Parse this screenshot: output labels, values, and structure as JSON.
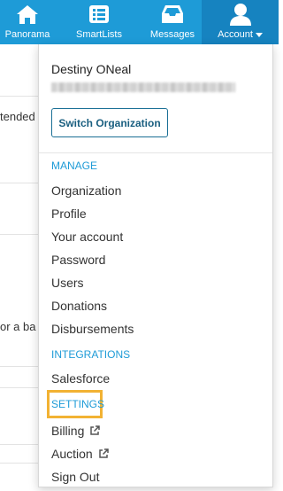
{
  "topbar": {
    "nav": [
      {
        "label": "Panorama",
        "icon": "home-icon"
      },
      {
        "label": "SmartLists",
        "icon": "list-icon"
      },
      {
        "label": "Messages",
        "icon": "inbox-icon"
      },
      {
        "label": "Account",
        "icon": "user-icon"
      }
    ]
  },
  "background": {
    "fragment1": "tended",
    "fragment2": "or a ba"
  },
  "dropdown": {
    "user_name": "Destiny ONeal",
    "switch_label": "Switch Organization",
    "manage_label": "MANAGE",
    "manage_items": [
      "Organization",
      "Profile",
      "Your account",
      "Password",
      "Users",
      "Donations",
      "Disbursements"
    ],
    "integrations_label": "INTEGRATIONS",
    "integrations_items": [
      "Salesforce"
    ],
    "settings_label": "SETTINGS",
    "settings_items": [
      "Billing",
      "Auction"
    ],
    "signout_label": "Sign Out"
  },
  "colors": {
    "topbar": "#1e9bd7",
    "account_active": "#1683c0",
    "section_label": "#1e9bd7",
    "highlight": "#f2b233"
  }
}
